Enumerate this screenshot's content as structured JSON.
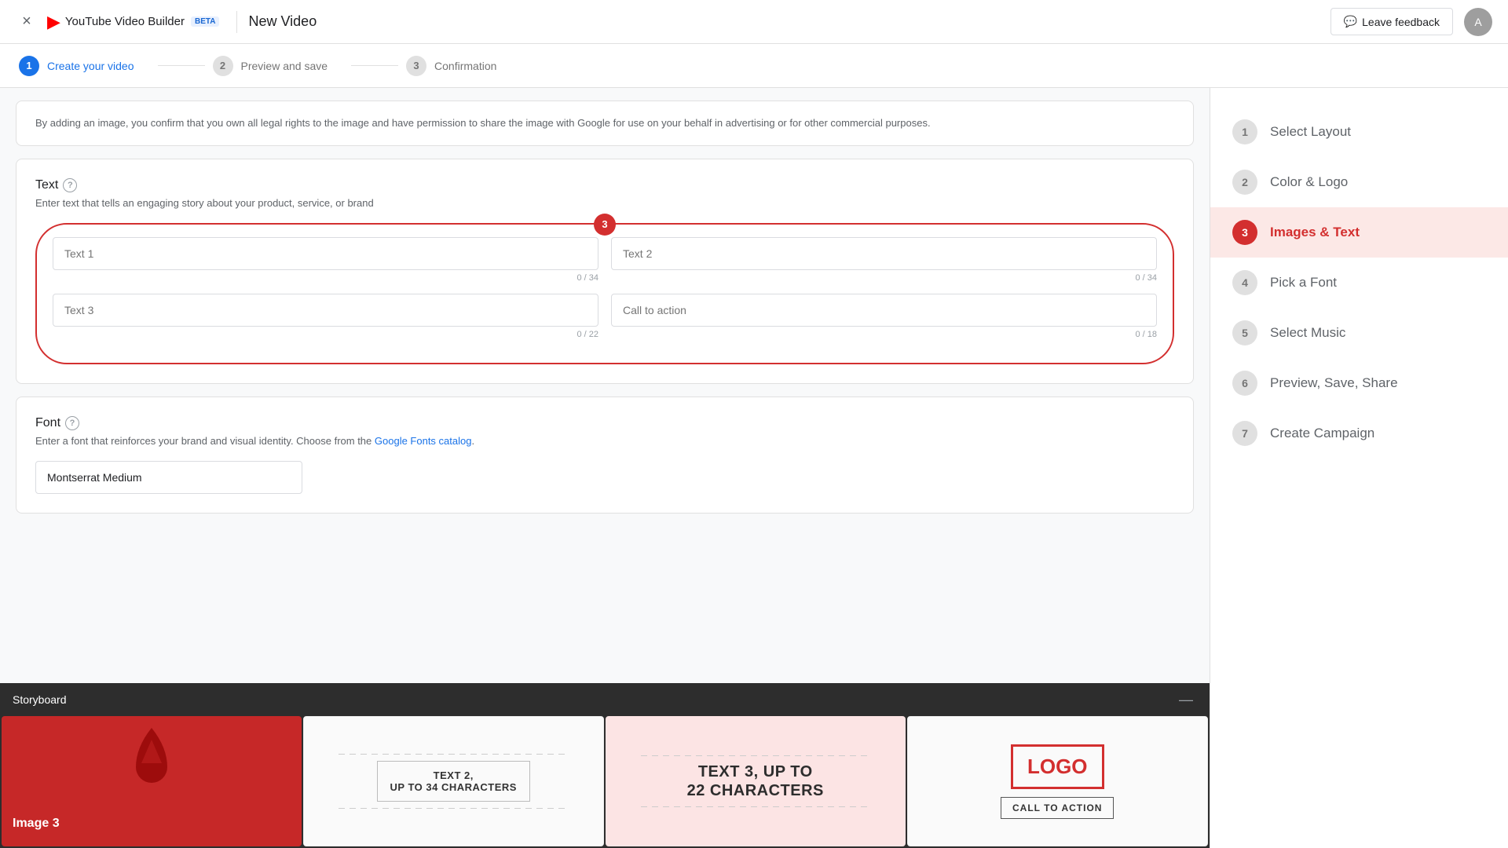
{
  "topbar": {
    "close_label": "×",
    "logo_text": "YouTube Video Builder",
    "logo_beta": "BETA",
    "divider": "|",
    "title": "New Video",
    "feedback_label": "Leave feedback",
    "feedback_icon": "💬",
    "avatar_letter": "A"
  },
  "steps": [
    {
      "num": "1",
      "label": "Create your video",
      "state": "active"
    },
    {
      "num": "2",
      "label": "Preview and save",
      "state": "inactive"
    },
    {
      "num": "3",
      "label": "Confirmation",
      "state": "inactive"
    }
  ],
  "info_bar": {
    "text": "By adding an image, you confirm that you own all legal rights to the image and have permission to share the image with Google for use on your behalf in advertising or for other commercial purposes."
  },
  "text_section": {
    "title": "Text",
    "help": "?",
    "subtitle": "Enter text that tells an engaging story about your product, service, or brand",
    "badge": "3",
    "fields": [
      {
        "placeholder": "Text 1",
        "value": "",
        "max": "34",
        "current": "0"
      },
      {
        "placeholder": "Text 2",
        "value": "",
        "max": "34",
        "current": "0"
      },
      {
        "placeholder": "Text 3",
        "value": "",
        "max": "22",
        "current": "0"
      },
      {
        "placeholder": "Call to action",
        "value": "",
        "max": "18",
        "current": "0"
      }
    ]
  },
  "font_section": {
    "title": "Font",
    "help": "?",
    "subtitle_start": "Enter a font that reinforces your brand and visual identity. Choose from the ",
    "link_text": "Google Fonts catalog",
    "subtitle_end": ".",
    "value": "Montserrat Medium"
  },
  "sidebar": {
    "items": [
      {
        "num": "1",
        "label": "Select Layout",
        "state": "inactive"
      },
      {
        "num": "2",
        "label": "Color & Logo",
        "state": "inactive"
      },
      {
        "num": "3",
        "label": "Images & Text",
        "state": "active"
      },
      {
        "num": "4",
        "label": "Pick a Font",
        "state": "inactive"
      },
      {
        "num": "5",
        "label": "Select Music",
        "state": "inactive"
      },
      {
        "num": "6",
        "label": "Preview, Save, Share",
        "state": "inactive"
      },
      {
        "num": "7",
        "label": "Create Campaign",
        "state": "inactive"
      }
    ]
  },
  "storyboard": {
    "title": "Storyboard",
    "minimize": "—",
    "frames": [
      {
        "type": "image",
        "label": "Image 3"
      },
      {
        "type": "text2",
        "line1": "TEXT 2,",
        "line2": "UP TO 34 CHARACTERS"
      },
      {
        "type": "text3",
        "line1": "TEXT 3, UP TO",
        "line2": "22 CHARACTERS"
      },
      {
        "type": "logo",
        "logo": "LOGO",
        "cta": "CALL TO ACTION"
      }
    ]
  }
}
